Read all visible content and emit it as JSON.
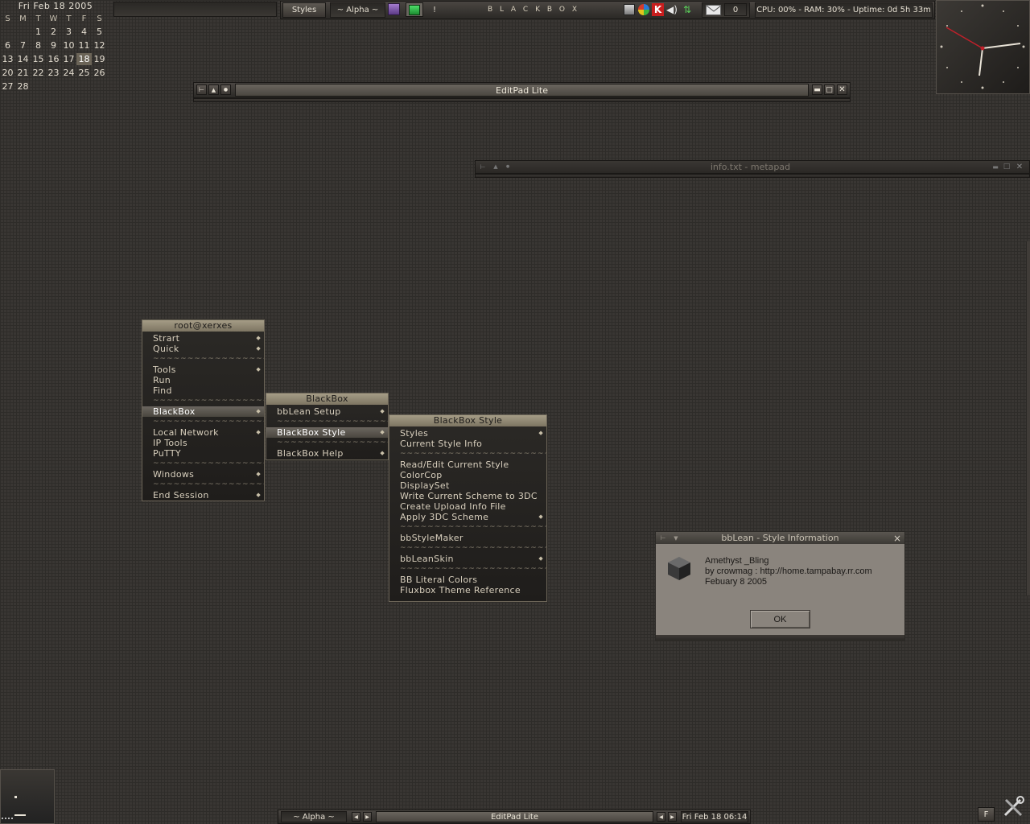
{
  "calendar": {
    "title": "Fri Feb 18  2005",
    "weekdays": [
      "S",
      "M",
      "T",
      "W",
      "T",
      "F",
      "S"
    ],
    "weeks": [
      [
        "",
        "",
        "1",
        "2",
        "3",
        "4",
        "5"
      ],
      [
        "6",
        "7",
        "8",
        "9",
        "10",
        "11",
        "12"
      ],
      [
        "13",
        "14",
        "15",
        "16",
        "17",
        "18",
        "19"
      ],
      [
        "20",
        "21",
        "22",
        "23",
        "24",
        "25",
        "26"
      ],
      [
        "27",
        "28",
        "",
        "",
        "",
        "",
        ""
      ]
    ],
    "today": "18"
  },
  "toolbar": {
    "styles_label": "Styles",
    "workspace_label": "~ Alpha ~",
    "exclaim_label": "!",
    "blackbox_label": "B L A C K B O X",
    "mail_count": "0",
    "system_status": "CPU: 00% - RAM: 30% - Uptime: 0d 5h 33m"
  },
  "windows": {
    "editpad_title": "EditPad Lite",
    "metapad_title": "info.txt - metapad"
  },
  "root_menu": {
    "title": "root@xerxes",
    "items": [
      {
        "label": "Strart",
        "submenu": true
      },
      {
        "label": "Quick",
        "submenu": true
      },
      {
        "label": "Tools",
        "submenu": true
      },
      {
        "label": "Run",
        "submenu": false
      },
      {
        "label": "Find",
        "submenu": false
      },
      {
        "label": "BlackBox",
        "submenu": true
      },
      {
        "label": "Local Network",
        "submenu": true
      },
      {
        "label": "IP Tools",
        "submenu": false
      },
      {
        "label": "PuTTY",
        "submenu": false
      },
      {
        "label": "Windows",
        "submenu": true
      },
      {
        "label": "End Session",
        "submenu": true
      }
    ]
  },
  "blackbox_menu": {
    "title": "BlackBox",
    "items": [
      {
        "label": "bbLean Setup"
      },
      {
        "label": "BlackBox Style"
      },
      {
        "label": "BlackBox Help"
      }
    ]
  },
  "style_menu": {
    "title": "BlackBox Style",
    "items": [
      {
        "label": "Styles"
      },
      {
        "label": "Current Style Info"
      },
      {
        "label": "Read/Edit Current Style"
      },
      {
        "label": "ColorCop"
      },
      {
        "label": "DisplaySet"
      },
      {
        "label": "Write Current Scheme to 3DC"
      },
      {
        "label": "Create Upload Info File"
      },
      {
        "label": "Apply 3DC Scheme"
      },
      {
        "label": "bbStyleMaker"
      },
      {
        "label": "bbLeanSkin"
      },
      {
        "label": "BB Literal Colors"
      },
      {
        "label": "Fluxbox Theme Reference"
      }
    ]
  },
  "style_dialog": {
    "title": "bbLean - Style Information",
    "style_name": "Amethyst _Bling",
    "author": "by crowmag : http://home.tampabay.rr.com",
    "date": "Febuary 8 2005",
    "ok_label": "OK",
    "close_label": "×"
  },
  "taskbar": {
    "workspace_label": "~ Alpha ~",
    "task_label": "EditPad Lite",
    "clock": "Fri Feb 18  06:14",
    "f_label": "F"
  },
  "separator_text": "~~~~~~~~~~~~~~~~~~~~~~~~~~~~~~~~",
  "colors": {
    "accent": "#a59c86",
    "desktop": "#393633",
    "clock_second_hand": "#c0202a"
  },
  "icons": {
    "window_menu": "window-menu-icon",
    "shade": "shade-icon",
    "sticky": "sticky-icon",
    "minimize": "minimize-icon",
    "maximize": "maximize-icon",
    "close": "close-icon",
    "mail": "mail-icon",
    "cube": "cube-icon",
    "tools": "tools-icon"
  }
}
